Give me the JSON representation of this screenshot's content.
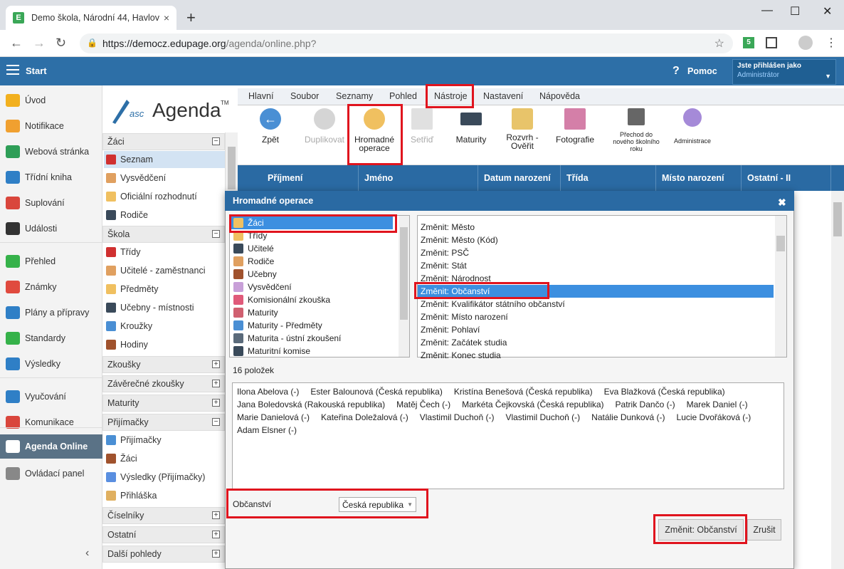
{
  "browser": {
    "tab_title": "Demo škola, Národní 44, Havlov",
    "tab_favicon": "E",
    "close_glyph": "×",
    "newtab_glyph": "+",
    "url_host": "https://democz.edupage.org",
    "url_path": "/agenda/online.php?",
    "extension_badge": "5"
  },
  "header": {
    "start_label": "Start",
    "help_label": "Pomoc",
    "help_glyph": "?",
    "login_line1": "Jste přihlášen jako",
    "login_line2": "Administrátor"
  },
  "sidebar": {
    "items": [
      {
        "label": "Úvod",
        "color": "#f2b01e"
      },
      {
        "label": "Notifikace",
        "color": "#f0a030"
      },
      {
        "label": "Webová stránka",
        "color": "#2e9e57"
      },
      {
        "label": "Třídní kniha",
        "color": "#2f7fc6"
      },
      {
        "label": "Suplování",
        "color": "#d9463c"
      },
      {
        "label": "Události",
        "color": "#333333"
      },
      {
        "label": "Přehled",
        "color": "#36b24a"
      },
      {
        "label": "Známky",
        "color": "#e04a3e"
      },
      {
        "label": "Plány a přípravy",
        "color": "#2f7fc6"
      },
      {
        "label": "Standardy",
        "color": "#36b24a"
      },
      {
        "label": "Výsledky",
        "color": "#2f7fc6"
      },
      {
        "label": "Vyučování",
        "color": "#2f7fc6"
      },
      {
        "label": "Komunikace",
        "color": "#d9463c"
      },
      {
        "label": "Agenda Online",
        "color": "#ffffff"
      },
      {
        "label": "Ovládací panel",
        "color": "#888888"
      }
    ]
  },
  "logo": {
    "asc": "asc",
    "agenda": "Agenda",
    "tm": "TM"
  },
  "tree": {
    "sections": [
      {
        "label": "Žáci",
        "sign": "−"
      },
      {
        "label": "Škola",
        "sign": "−"
      },
      {
        "label": "Zkoušky",
        "sign": "+"
      },
      {
        "label": "Závěrečné zkoušky",
        "sign": "+"
      },
      {
        "label": "Maturity",
        "sign": "+"
      },
      {
        "label": "Přijímačky",
        "sign": "−"
      },
      {
        "label": "Číselníky",
        "sign": "+"
      },
      {
        "label": "Ostatní",
        "sign": "+"
      },
      {
        "label": "Další pohledy",
        "sign": "+"
      }
    ],
    "zaci_items": [
      "Seznam",
      "Vysvědčení",
      "Oficiální rozhodnutí",
      "Rodiče"
    ],
    "skola_items": [
      "Třídy",
      "Učitelé - zaměstnanci",
      "Předměty",
      "Učebny - místnosti",
      "Kroužky",
      "Hodiny"
    ],
    "prijimacky_items": [
      "Přijímačky",
      "Žáci",
      "Výsledky (Přijímačky)",
      "Přihláška"
    ]
  },
  "menu": [
    "Hlavní",
    "Soubor",
    "Seznamy",
    "Pohled",
    "Nástroje",
    "Nastavení",
    "Nápověda"
  ],
  "toolbar": {
    "zpet": "Zpět",
    "duplikovat": "Duplikovat",
    "hromadne_1": "Hromadné",
    "hromadne_2": "operace",
    "setrid": "Setřiď",
    "maturity": "Maturity",
    "rozvrh_1": "Rozvrh -",
    "rozvrh_2": "Ověřit",
    "fotografie": "Fotografie",
    "prechod_1": "Přechod do",
    "prechod_2": "nového školního",
    "prechod_3": "roku",
    "administrace": "Administrace"
  },
  "grid_headers": [
    "Příjmení",
    "Jméno",
    "Datum narození",
    "Třída",
    "Místo narození",
    "Ostatní - II"
  ],
  "dialog": {
    "title": "Hromadné operace",
    "close": "✖",
    "left_list": [
      "Žáci",
      "Třídy",
      "Učitelé",
      "Rodiče",
      "Učebny",
      "Vysvědčení",
      "Komisionální zkouška",
      "Maturity",
      "Maturity - Předměty",
      "Maturita - ústní zkoušení",
      "Maturitní komise"
    ],
    "right_list": [
      "Změnit: Město",
      "Změnit: Město (Kód)",
      "Změnit: PSČ",
      "Změnit: Stát",
      "Změnit: Národnost",
      "Změnit: Občanství",
      "Změnit: Kvalifikátor státního občanství",
      "Změnit: Místo narození",
      "Změnit: Pohlaví",
      "Změnit: Začátek studia",
      "Změnit: Konec studia"
    ],
    "count_label": "16 položek",
    "names_line1": [
      "Ilona Abelova (-)",
      "Ester Balounová (Česká republika)",
      "Kristína Benešová (Česká republika)",
      "Eva Blažková (Česká republika)"
    ],
    "names_line2": [
      "Jana Boledovská (Rakouská republika)",
      "Matěj Čech (-)",
      "Markéta Čejkovská (Česká republika)",
      "Patrik Dančo (-)",
      "Marek Daniel (-)"
    ],
    "names_line3": [
      "Marie Danielová (-)",
      "Kateřina Doležalová (-)",
      "Vlastimil Duchoň (-)",
      "Vlastimil Duchoň (-)",
      "Natálie Dunková (-)",
      "Lucie Dvořáková (-)"
    ],
    "names_line4": [
      "Adam Elsner (-)"
    ],
    "field_label": "Občanství",
    "field_value": "Česká republika",
    "submit": "Změnit: Občanství",
    "cancel": "Zrušit"
  }
}
